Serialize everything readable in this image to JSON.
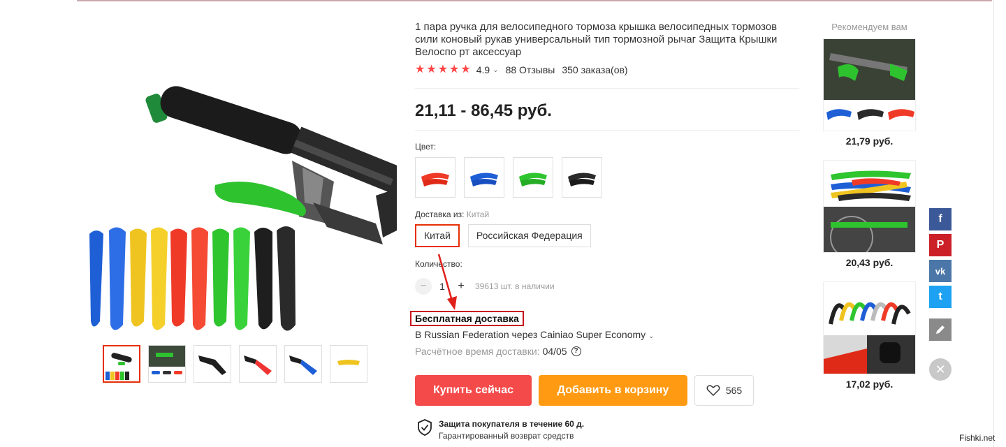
{
  "product": {
    "title": "1 пара ручка для велосипедного тормоза крышка велосипедных тормозов сили коновый рукав универсальный тип тормозной рычаг Защита Крышки Велоспо рт аксессуар",
    "rating": "4.9",
    "reviews": "88 Отзывы",
    "orders": "350 заказа(ов)",
    "stars": 5,
    "price": "21,11 - 86,45 руб."
  },
  "color": {
    "label": "Цвет:",
    "options": [
      "red",
      "blue",
      "green",
      "black"
    ]
  },
  "shipping_from": {
    "label": "Доставка из:",
    "selected": "Китай",
    "options": [
      "Китай",
      "Российская Федерация"
    ]
  },
  "quantity": {
    "label": "Количество:",
    "minus": "−",
    "value": "1",
    "plus": "+",
    "stock": "39613 шт. в наличии"
  },
  "delivery": {
    "free": "Бесплатная доставка",
    "via": "В Russian Federation через Cainiao Super Economy",
    "eta_label": "Расчётное время доставки:",
    "eta_date": "04/05",
    "help": "?"
  },
  "actions": {
    "buy": "Купить сейчас",
    "cart": "Добавить в корзину",
    "wish_count": "565"
  },
  "protection": {
    "title": "Защита покупателя в течение 60 д.",
    "subtitle": "Гарантированный возврат средств"
  },
  "recommend": {
    "title": "Рекомендуем вам",
    "items": [
      {
        "price": "21,79 руб."
      },
      {
        "price": "20,43 руб."
      },
      {
        "price": "17,02 руб."
      }
    ]
  },
  "social": {
    "facebook": "f",
    "pinterest": "P",
    "vk": "vk",
    "twitter": "t",
    "close": "✕"
  },
  "colors": {
    "accent_red": "#f44a4a",
    "accent_orange": "#ff9a12",
    "facebook": "#3b5998",
    "pinterest": "#cb2027",
    "vk": "#4a76a8",
    "twitter": "#1da1f2"
  },
  "watermark": "Fishki.net"
}
